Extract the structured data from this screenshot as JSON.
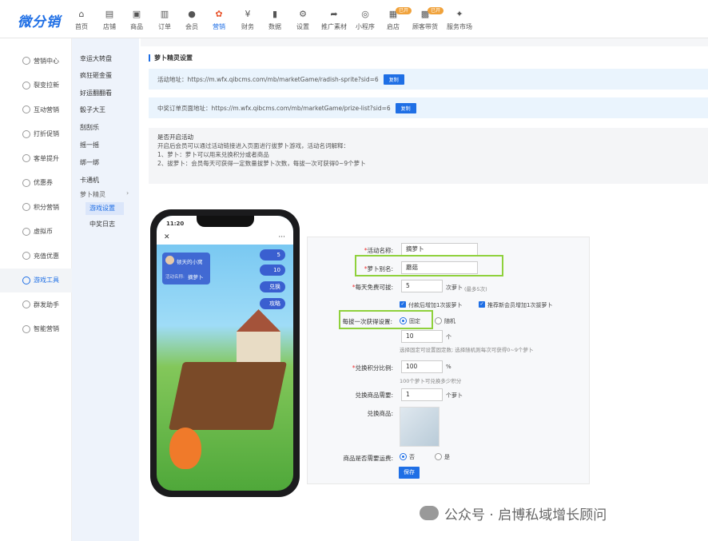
{
  "logo": "微分销",
  "nav": [
    {
      "label": "首页",
      "icon": "home-icon",
      "glyph": "⌂"
    },
    {
      "label": "店铺",
      "icon": "store-icon",
      "glyph": "▤"
    },
    {
      "label": "商品",
      "icon": "goods-icon",
      "glyph": "▣"
    },
    {
      "label": "订单",
      "icon": "order-icon",
      "glyph": "▥"
    },
    {
      "label": "会员",
      "icon": "member-icon",
      "glyph": "●"
    },
    {
      "label": "营销",
      "icon": "marketing-icon",
      "glyph": "✿",
      "active": true
    },
    {
      "label": "财务",
      "icon": "finance-icon",
      "glyph": "¥"
    },
    {
      "label": "数据",
      "icon": "data-icon",
      "glyph": "▮"
    },
    {
      "label": "设置",
      "icon": "settings-icon",
      "glyph": "⚙"
    },
    {
      "label": "推广素材",
      "icon": "share-icon",
      "glyph": "➦"
    },
    {
      "label": "小程序",
      "icon": "miniapp-icon",
      "glyph": "◎"
    },
    {
      "label": "启店",
      "icon": "open-store-icon",
      "glyph": "▦",
      "badge": "已开"
    },
    {
      "label": "顾客带货",
      "icon": "customer-icon",
      "glyph": "▩",
      "badge": "已开"
    },
    {
      "label": "服务市场",
      "icon": "market-icon",
      "glyph": "✦"
    }
  ],
  "sidebar1": [
    {
      "label": "营销中心",
      "key": "marketing-center"
    },
    {
      "label": "裂变拉新",
      "key": "fission"
    },
    {
      "label": "互动营销",
      "key": "interactive"
    },
    {
      "label": "打折促销",
      "key": "discount"
    },
    {
      "label": "客单提升",
      "key": "order-value"
    },
    {
      "label": "优惠券",
      "key": "coupon"
    },
    {
      "label": "积分营销",
      "key": "points"
    },
    {
      "label": "虚拟币",
      "key": "virtual-coin"
    },
    {
      "label": "充值优惠",
      "key": "recharge"
    },
    {
      "label": "游戏工具",
      "key": "game-tools",
      "active": true
    },
    {
      "label": "群发助手",
      "key": "mass-send"
    },
    {
      "label": "智能营销",
      "key": "smart"
    }
  ],
  "sidebar2": {
    "items": [
      "幸运大转盘",
      "疯狂砸金蛋",
      "好运翻翻看",
      "骰子大王",
      "刮刮乐",
      "摇一摇",
      "绑一绑",
      "卡通机"
    ],
    "group": "萝卜精灵",
    "subitems": [
      "游戏设置",
      "中奖日志"
    ]
  },
  "page_title": "萝卜精灵设置",
  "activity_url": {
    "label": "活动地址：",
    "value": "https://m.wfx.qibcms.com/mb/marketGame/radish-sprite?sid=6",
    "button": "复制"
  },
  "prize_url": {
    "label": "中奖订单页面地址：",
    "value": "https://m.wfx.qibcms.com/mb/marketGame/prize-list?sid=6",
    "button": "复制"
  },
  "description": {
    "title": "是否开启活动",
    "line1": "开启后会员可以通过活动链接进入页面进行拔萝卜游戏，活动名词解释：",
    "line2": "1、萝卜：萝卜可以用来兑换积分或者商品",
    "line3": "2、拔萝卜：会员每天可获得一定数量拔萝卜次数，每拔一次可获得0~9个萝卜"
  },
  "phone": {
    "time": "11:20",
    "close": "✕",
    "more": "···",
    "username": "顿天的小窝",
    "activity_label": "活动名称:",
    "activity_value": "摘萝卜",
    "count1": "5",
    "count2": "10",
    "btn_exchange": "兑换",
    "btn_strategy": "攻略"
  },
  "form": {
    "name_label": "活动名称:",
    "name_value": "摘萝卜",
    "alias_label": "萝卜别名:",
    "alias_value": "蘑菇",
    "free_label": "每天免费可拔:",
    "free_value": "5",
    "free_unit": "次萝卜",
    "free_hint": "(最多5次)",
    "check1": "付款后增加1次拔萝卜",
    "check2": "推荐新会员增加1次拔萝卜",
    "get_label": "每拔一次获得设置:",
    "opt_fixed": "固定",
    "opt_random": "随机",
    "get_value": "10",
    "get_unit": "个",
    "get_hint": "选择固定可设置固定数; 选择随机则每次可获得0~9个萝卜",
    "ratio_label": "兑换积分比例:",
    "ratio_value": "100",
    "ratio_unit": "%",
    "ratio_hint": "100个萝卜可兑换多少积分",
    "need_label": "兑换商品需要:",
    "need_value": "1",
    "need_unit": "个萝卜",
    "product_label": "兑换商品:",
    "shipping_label": "商品是否需要运费:",
    "opt_no": "否",
    "opt_yes": "是",
    "save": "保存"
  },
  "watermark": "公众号 · 启博私域增长顾问"
}
